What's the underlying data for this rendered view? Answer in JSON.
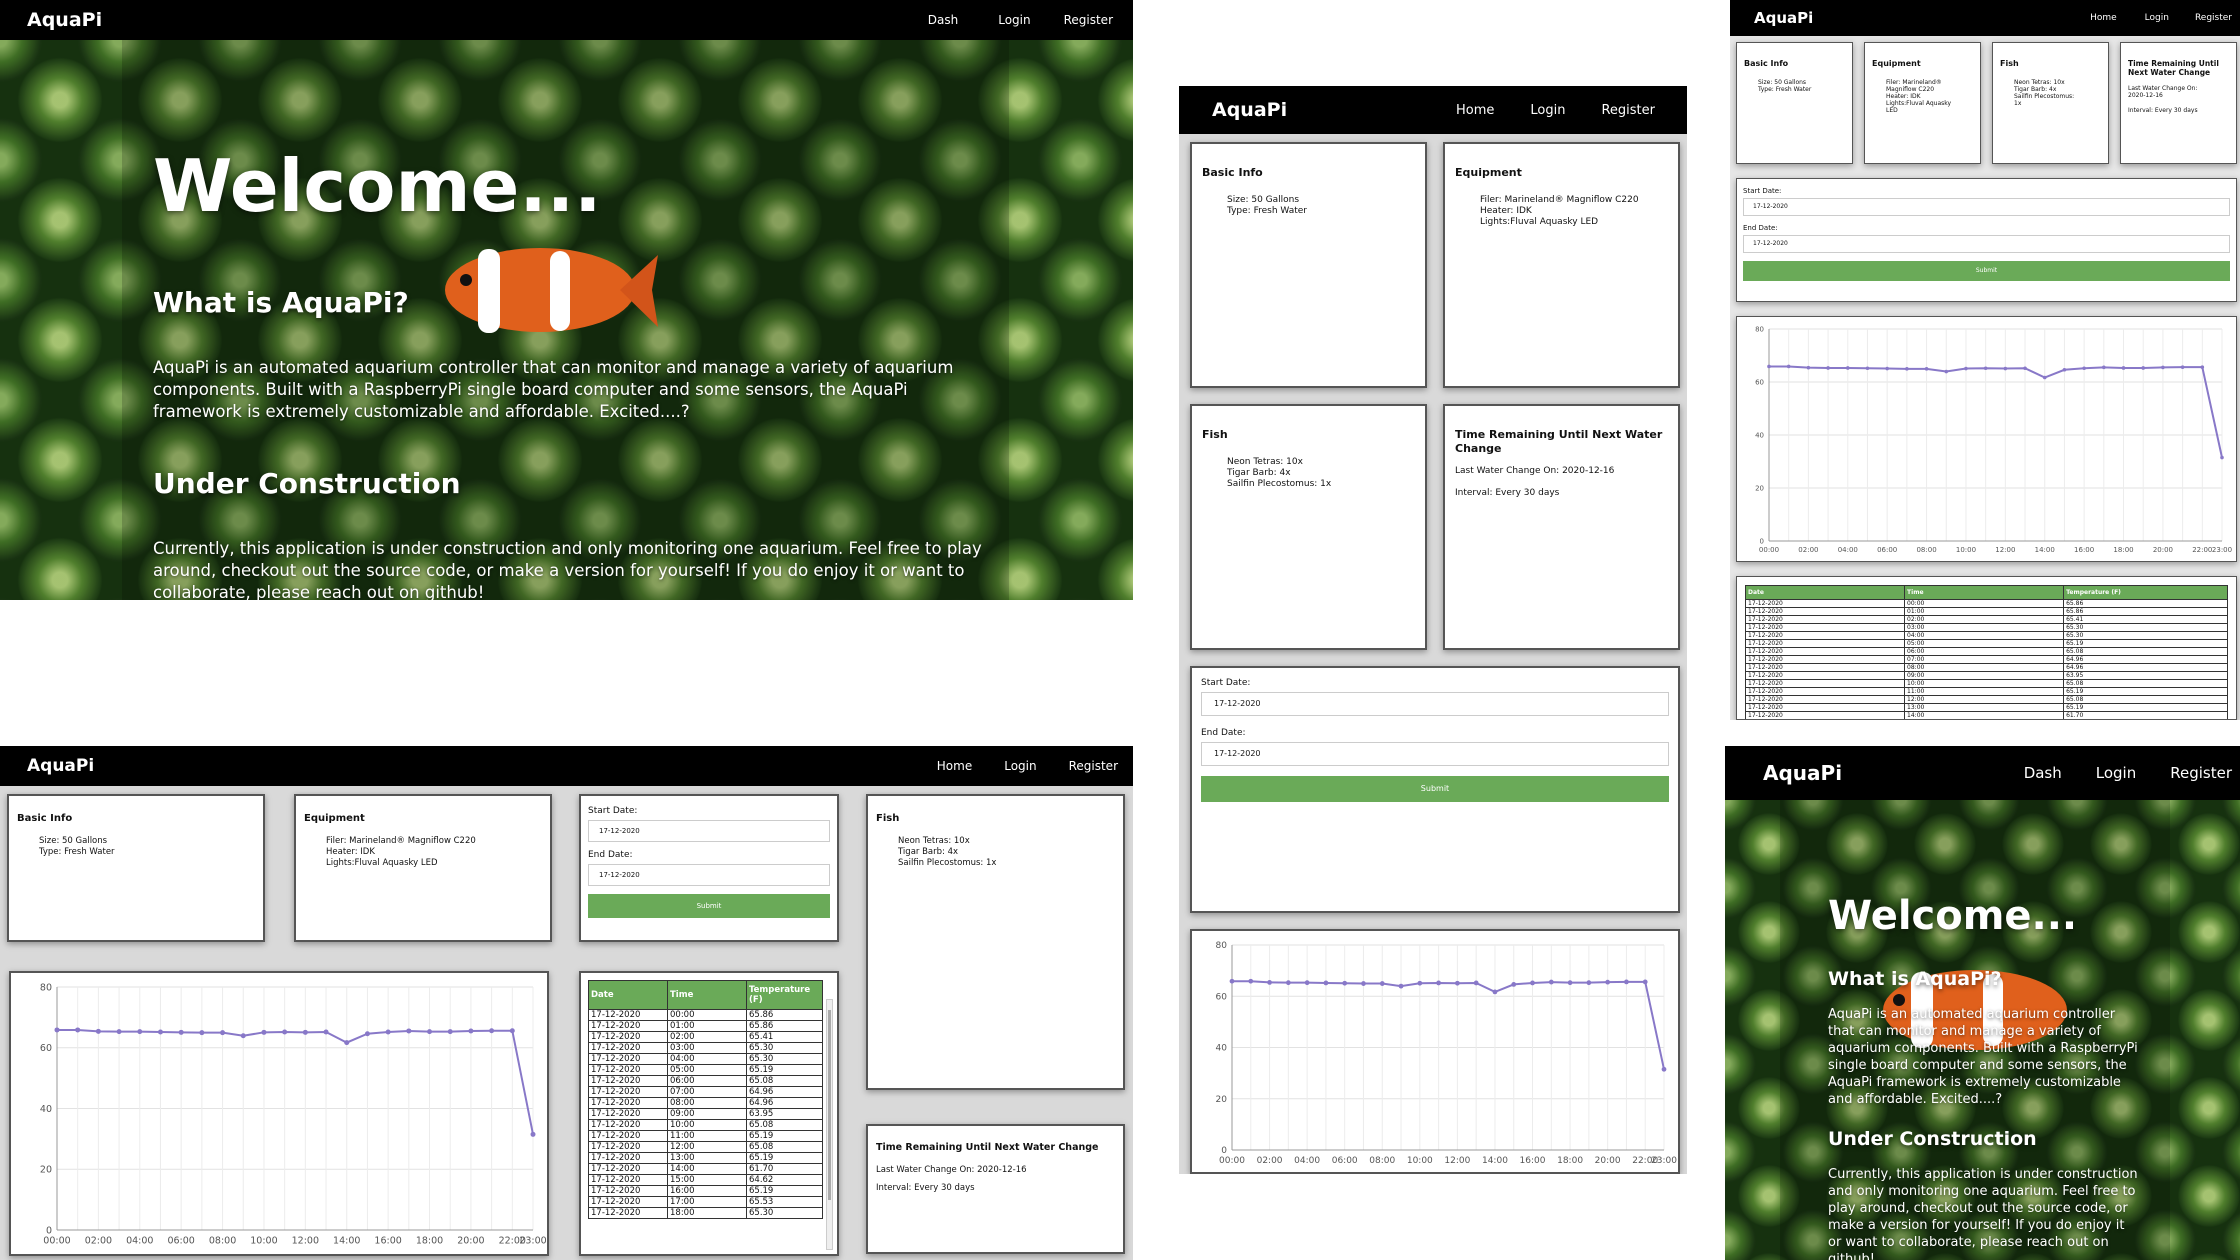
{
  "brand": "AquaPi",
  "nav_dash": [
    "Dash",
    "Login",
    "Register"
  ],
  "nav_home": [
    "Home",
    "Login",
    "Register"
  ],
  "welcome": {
    "title": "Welcome...",
    "what_title": "What is AquaPi?",
    "what_text": "AquaPi is an automated aquarium controller that can monitor and manage a variety of aquarium components. Built with a RaspberryPi single board computer and some sensors, the AquaPi framework is extremely customizable and affordable. Excited....?",
    "uc_title": "Under Construction",
    "uc_text": "Currently, this application is under construction and only monitoring one aquarium. Feel free to play around, checkout out the source code, or make a version for yourself! If you do enjoy it or want to collaborate, please reach out on github!"
  },
  "basic_info": {
    "title": "Basic Info",
    "items": [
      "Size: 50 Gallons",
      "Type: Fresh Water"
    ]
  },
  "equipment": {
    "title": "Equipment",
    "items": [
      "Filer: Marineland® Magniflow C220",
      "Heater: IDK",
      "Lights:Fluval Aquasky LED"
    ]
  },
  "equipment_narrow": [
    "Filer: Marineland®",
    "Magniflow C220",
    "Heater: IDK",
    "Lights:Fluval Aquasky",
    "LED"
  ],
  "fish": {
    "title": "Fish",
    "items": [
      "Neon Tetras: 10x",
      "Tigar Barb: 4x",
      "Sailfin Plecostomus: 1x"
    ]
  },
  "fish_narrow": [
    "Neon Tetras: 10x",
    "Tigar Barb: 4x",
    "Sailfin Plecostomus:",
    "1x"
  ],
  "water": {
    "title": "Time Remaining Until Next Water Change",
    "last": "Last Water Change On: 2020-12-16",
    "interval": "Interval: Every 30 days"
  },
  "water_narrow": {
    "title_lines": [
      "Time Remaining Until",
      "Next Water Change"
    ],
    "last_lines": [
      "Last Water Change On:",
      "2020-12-16"
    ],
    "interval": "Interval: Every 30 days"
  },
  "form": {
    "start_label": "Start Date:",
    "start_value": "17-12-2020",
    "end_label": "End Date:",
    "end_value": "17-12-2020",
    "submit": "Submit"
  },
  "table": {
    "headers": [
      "Date",
      "Time",
      "Temperature (F)"
    ],
    "rows": [
      [
        "17-12-2020",
        "00:00",
        "65.86"
      ],
      [
        "17-12-2020",
        "01:00",
        "65.86"
      ],
      [
        "17-12-2020",
        "02:00",
        "65.41"
      ],
      [
        "17-12-2020",
        "03:00",
        "65.30"
      ],
      [
        "17-12-2020",
        "04:00",
        "65.30"
      ],
      [
        "17-12-2020",
        "05:00",
        "65.19"
      ],
      [
        "17-12-2020",
        "06:00",
        "65.08"
      ],
      [
        "17-12-2020",
        "07:00",
        "64.96"
      ],
      [
        "17-12-2020",
        "08:00",
        "64.96"
      ],
      [
        "17-12-2020",
        "09:00",
        "63.95"
      ],
      [
        "17-12-2020",
        "10:00",
        "65.08"
      ],
      [
        "17-12-2020",
        "11:00",
        "65.19"
      ],
      [
        "17-12-2020",
        "12:00",
        "65.08"
      ],
      [
        "17-12-2020",
        "13:00",
        "65.19"
      ],
      [
        "17-12-2020",
        "14:00",
        "61.70"
      ],
      [
        "17-12-2020",
        "15:00",
        "64.62"
      ],
      [
        "17-12-2020",
        "16:00",
        "65.19"
      ],
      [
        "17-12-2020",
        "17:00",
        "65.53"
      ],
      [
        "17-12-2020",
        "18:00",
        "65.30"
      ]
    ]
  },
  "chart_data": [
    {
      "type": "line",
      "title": "",
      "x": [
        "00:00",
        "01:00",
        "02:00",
        "03:00",
        "04:00",
        "05:00",
        "06:00",
        "07:00",
        "08:00",
        "09:00",
        "10:00",
        "11:00",
        "12:00",
        "13:00",
        "14:00",
        "15:00",
        "16:00",
        "17:00",
        "18:00",
        "19:00",
        "20:00",
        "21:00",
        "22:00",
        "23:00"
      ],
      "y": [
        65.86,
        65.86,
        65.41,
        65.3,
        65.3,
        65.19,
        65.08,
        64.96,
        64.96,
        63.95,
        65.08,
        65.19,
        65.08,
        65.19,
        61.7,
        64.62,
        65.19,
        65.53,
        65.3,
        65.3,
        65.5,
        65.6,
        65.6,
        31.5
      ],
      "ylim": [
        0,
        80
      ],
      "yticks": [
        0,
        20,
        40,
        60,
        80
      ],
      "grid": true,
      "color": "#8878c8"
    }
  ],
  "colors": {
    "nav": "#000000",
    "accent": "#6aaa58",
    "line": "#8878c8",
    "page_bg": "#d9d9d9"
  }
}
